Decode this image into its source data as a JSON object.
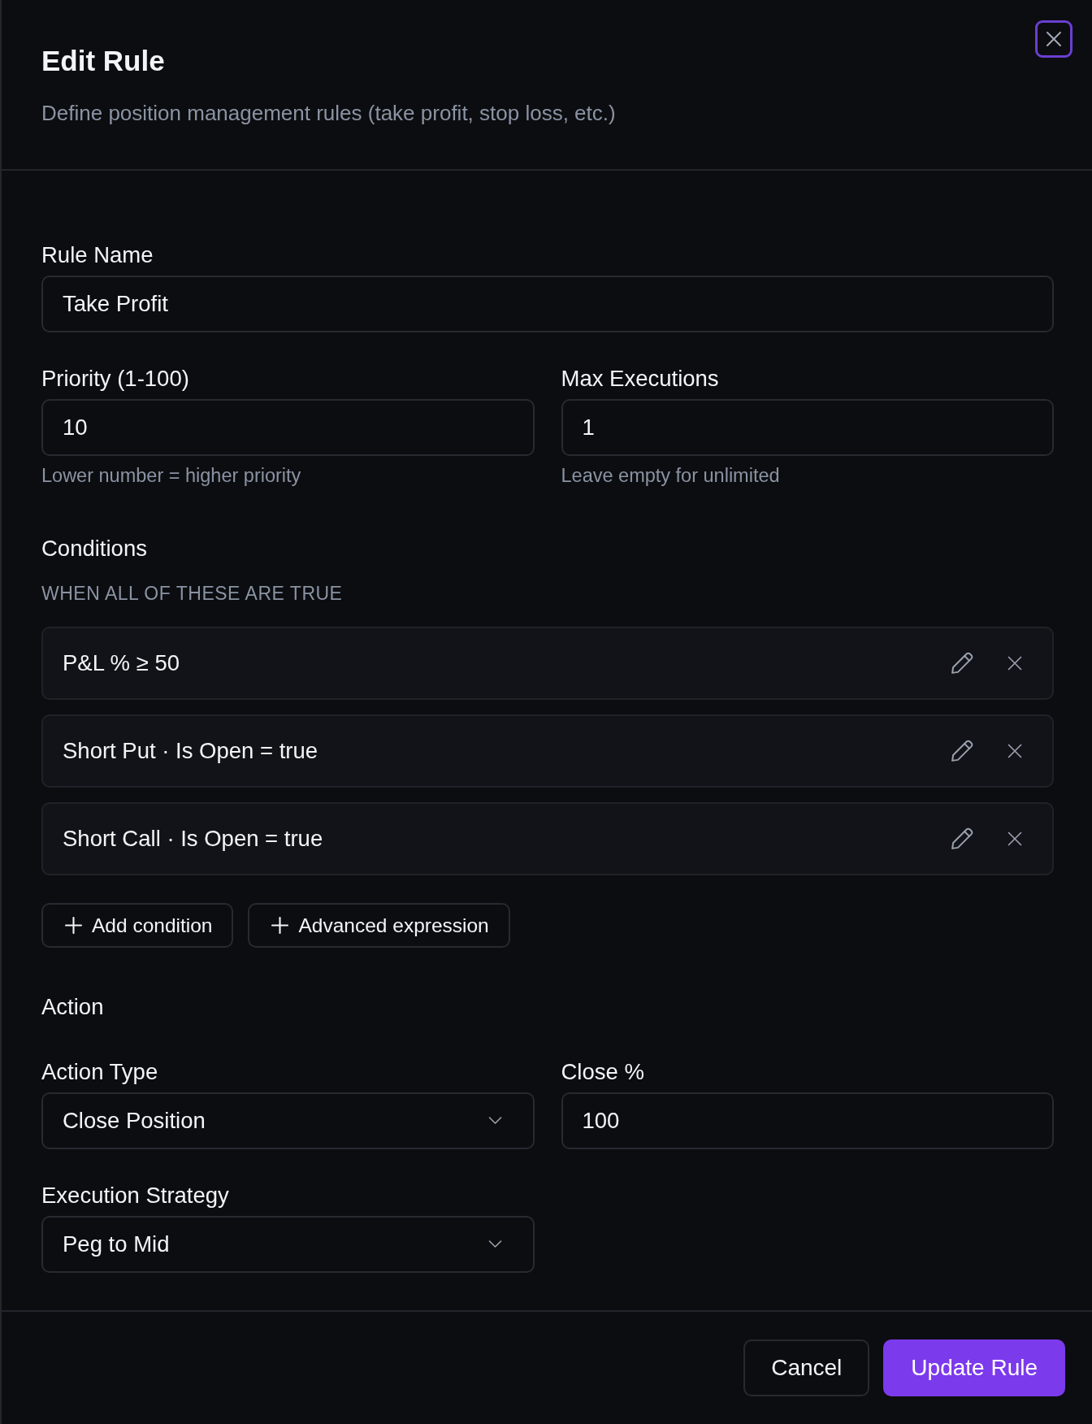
{
  "dialog": {
    "title": "Edit Rule",
    "subtitle": "Define position management rules (take profit, stop loss, etc.)",
    "close_button": {
      "focused": true
    }
  },
  "rule_name": {
    "label": "Rule Name",
    "value": "Take Profit"
  },
  "limits": [
    {
      "label": "Priority (1-100)",
      "value": "10",
      "helper": "Lower number = higher priority"
    },
    {
      "label": "Max Executions",
      "value": "1",
      "helper": "Leave empty for unlimited"
    }
  ],
  "conditions": {
    "heading": "Conditions",
    "mode_label": "WHEN ALL OF THESE ARE TRUE",
    "items": [
      {
        "text": "P&L % ≥ 50"
      },
      {
        "text": "Short Put · Is Open = true"
      },
      {
        "text": "Short Call · Is Open = true"
      }
    ],
    "buttons": [
      {
        "label": "Add condition"
      },
      {
        "label": "Advanced expression"
      }
    ]
  },
  "action": {
    "heading": "Action",
    "fields": [
      {
        "kind": "select",
        "label": "Action Type",
        "value": "Close Position"
      },
      {
        "kind": "input",
        "label": "Close %",
        "value": "100"
      },
      {
        "kind": "select",
        "label": "Execution Strategy",
        "value": "Peg to Mid"
      }
    ]
  },
  "footer": {
    "buttons": [
      {
        "kind": "secondary",
        "label": "Cancel"
      },
      {
        "kind": "primary",
        "label": "Update Rule"
      }
    ]
  }
}
